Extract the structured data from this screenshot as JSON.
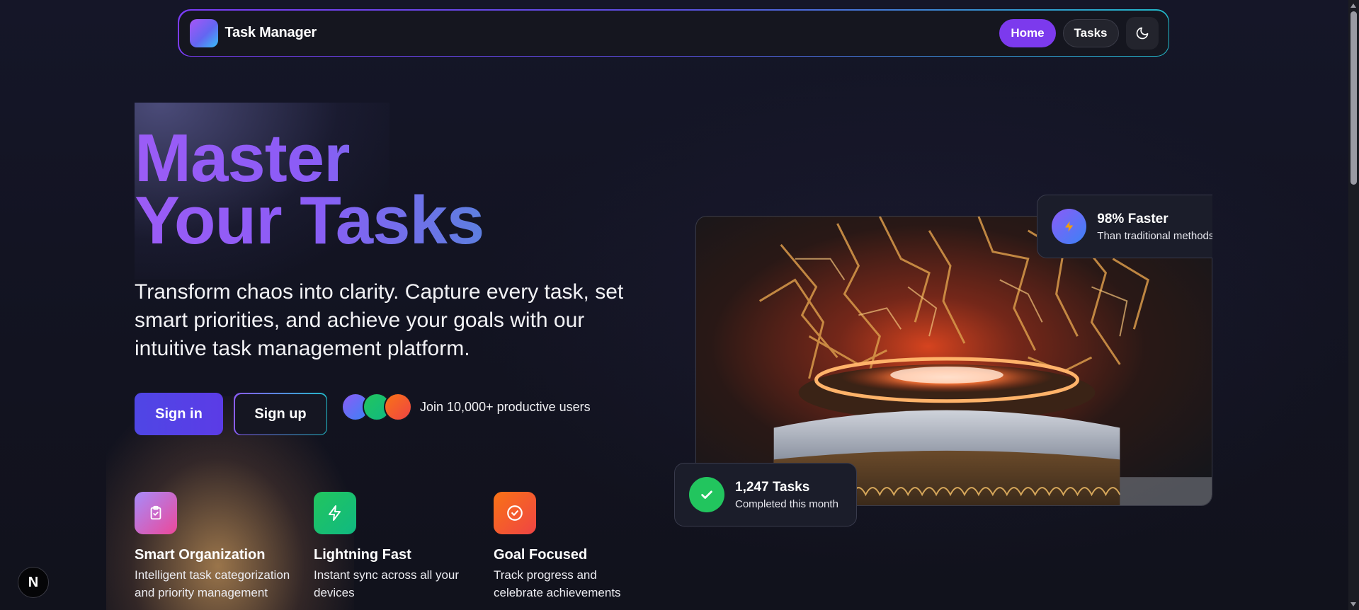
{
  "nav": {
    "brand": "Task Manager",
    "links": [
      {
        "label": "Home",
        "active": true
      },
      {
        "label": "Tasks",
        "active": false
      }
    ],
    "theme_toggle_icon": "moon-icon"
  },
  "hero": {
    "headline_line1": "Master",
    "headline_line2": "Your Tasks",
    "subtitle": "Transform chaos into clarity. Capture every task, set smart priorities, and achieve your goals with our intuitive task management platform.",
    "sign_in_label": "Sign in",
    "sign_up_label": "Sign up",
    "social_proof": "Join 10,000+ productive users",
    "avatar_colors": [
      "#6366f1",
      "#22c55e",
      "#f97316"
    ]
  },
  "features": [
    {
      "icon": "clipboard-check-icon",
      "title": "Smart Organization",
      "description": "Intelligent task categorization and priority management"
    },
    {
      "icon": "lightning-icon",
      "title": "Lightning Fast",
      "description": "Instant sync across all your devices"
    },
    {
      "icon": "target-check-icon",
      "title": "Goal Focused",
      "description": "Track progress and celebrate achievements"
    }
  ],
  "stats": {
    "speed_title": "98% Faster",
    "speed_subtitle": "Than traditional methods",
    "tasks_title": "1,247 Tasks",
    "tasks_subtitle": "Completed this month"
  },
  "dev_badge": "N",
  "colors": {
    "accent": "#7c3aed",
    "primary_button": "#4f46e5",
    "success": "#22c55e",
    "background": "#121322"
  }
}
